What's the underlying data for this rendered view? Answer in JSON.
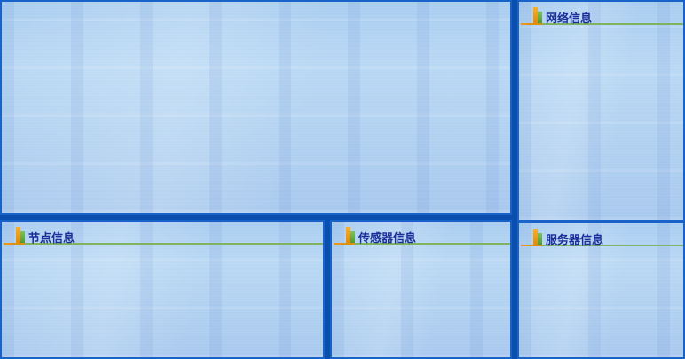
{
  "panels": {
    "main": {
      "title": ""
    },
    "network": {
      "title": "网络信息"
    },
    "node": {
      "title": "节点信息"
    },
    "sensor": {
      "title": "传感器信息"
    },
    "server": {
      "title": "服务器信息"
    }
  },
  "colors": {
    "frame": "#0a4fb0",
    "panel_border": "#1763c8",
    "title_text": "#1b2f9a",
    "header_line": "#7fb35f",
    "icon_orange": "#f7b02a",
    "icon_green": "#7cc35a"
  }
}
